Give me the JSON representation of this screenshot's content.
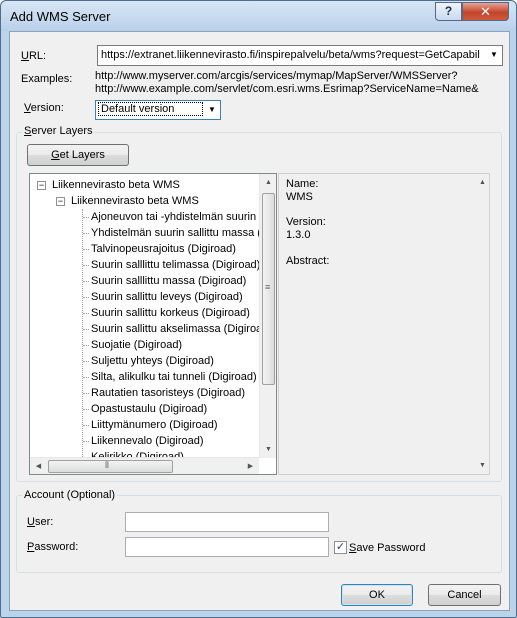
{
  "window": {
    "title": "Add WMS Server",
    "help_label": "?",
    "close_label": "✕"
  },
  "url": {
    "label_prefix": "",
    "label_accel": "U",
    "label_rest": "RL:",
    "value": "https://extranet.liikennevirasto.fi/inspirepalvelu/beta/wms?request=GetCapabil"
  },
  "examples": {
    "label": "Examples:",
    "lines": [
      "http://www.myserver.com/arcgis/services/mymap/MapServer/WMSServer?",
      "http://www.example.com/servlet/com.esri.wms.Esrimap?ServiceName=Name&"
    ]
  },
  "version": {
    "label_accel": "V",
    "label_rest": "ersion:",
    "value": "Default version"
  },
  "server_layers": {
    "title_accel": "S",
    "title_rest": "erver Layers",
    "get_layers_accel": "G",
    "get_layers_rest": "et Layers",
    "root": "Liikennevirasto beta WMS",
    "child": "Liikennevirasto beta WMS",
    "layers": [
      "Ajoneuvon tai -yhdistelmän suurin",
      "Yhdistelmän suurin sallittu massa (",
      "Talvinopeusrajoitus (Digiroad)",
      "Suurin salllittu telimassa (Digiroad)",
      "Suurin salllittu massa (Digiroad)",
      "Suurin sallittu leveys (Digiroad)",
      "Suurin sallittu korkeus (Digiroad)",
      "Suurin sallittu akselimassa (Digiroad",
      "Suojatie (Digiroad)",
      "Suljettu yhteys (Digiroad)",
      "Silta, alikulku tai tunneli (Digiroad)",
      "Rautatien tasoristeys (Digiroad)",
      "Opastustaulu (Digiroad)",
      "Liittymänumero (Digiroad)",
      "Liikennevalo (Digiroad)",
      "Kelirikko (Digiroad)"
    ],
    "info": {
      "name_label": "Name:",
      "name_value": "WMS",
      "version_label": "Version:",
      "version_value": "1.3.0",
      "abstract_label": "Abstract:"
    }
  },
  "account": {
    "title": "Account (Optional)",
    "user_accel": "U",
    "user_rest": "ser:",
    "user_value": "",
    "password_accel": "P",
    "password_rest": "assword:",
    "password_value": "",
    "save_password_accel": "S",
    "save_password_rest": "ave Password",
    "save_password_checked": true,
    "check_glyph": "✓"
  },
  "buttons": {
    "ok": "OK",
    "cancel": "Cancel"
  }
}
